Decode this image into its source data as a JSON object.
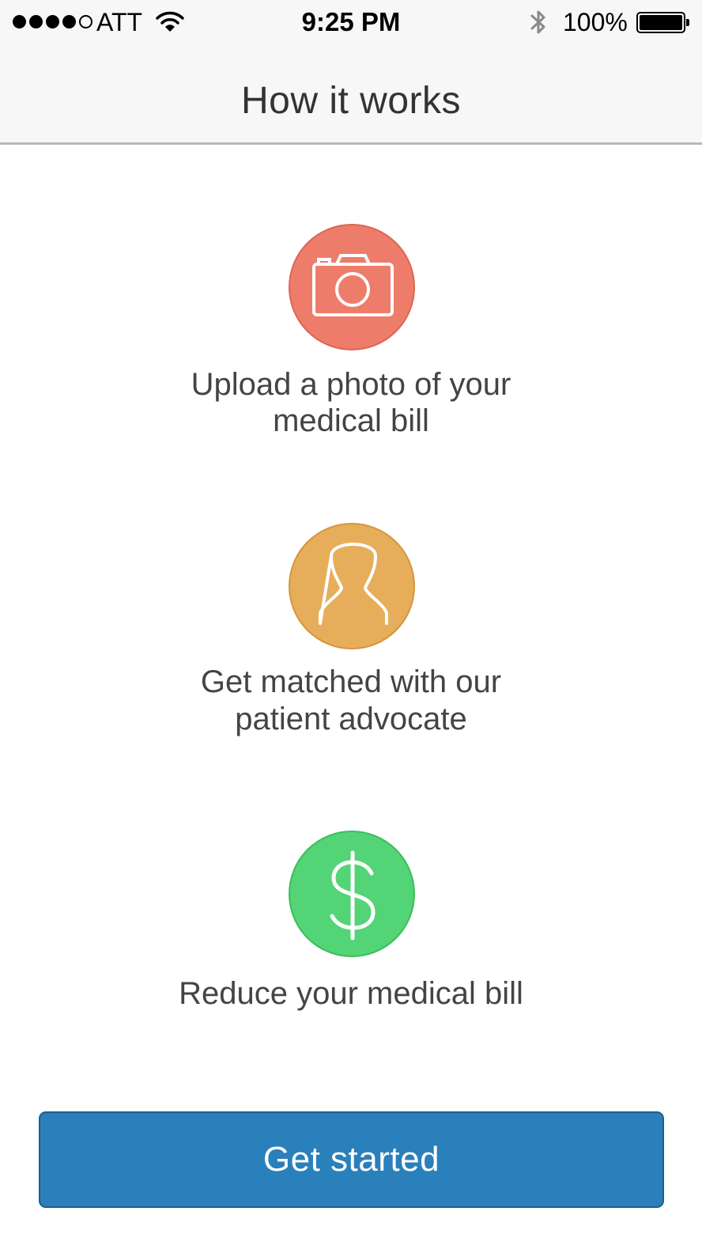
{
  "status_bar": {
    "carrier": "ATT",
    "time": "9:25 PM",
    "battery_percent": "100%",
    "battery_level": 1.0,
    "signal_bars_filled": 4,
    "signal_bars_total": 5,
    "icons": [
      "wifi-icon",
      "bluetooth-icon",
      "battery-icon"
    ]
  },
  "nav": {
    "title": "How it works"
  },
  "steps": [
    {
      "icon": "camera-icon",
      "color": "#ee7c6b",
      "line1": "Upload a photo of your",
      "line2": "medical bill"
    },
    {
      "icon": "person-icon",
      "color": "#e6ae5a",
      "line1": "Get matched with our",
      "line2": "patient advocate"
    },
    {
      "icon": "dollar-icon",
      "color": "#53d476",
      "line1": "Reduce your medical bill"
    }
  ],
  "cta": {
    "label": "Get started",
    "color": "#2a80ba"
  }
}
